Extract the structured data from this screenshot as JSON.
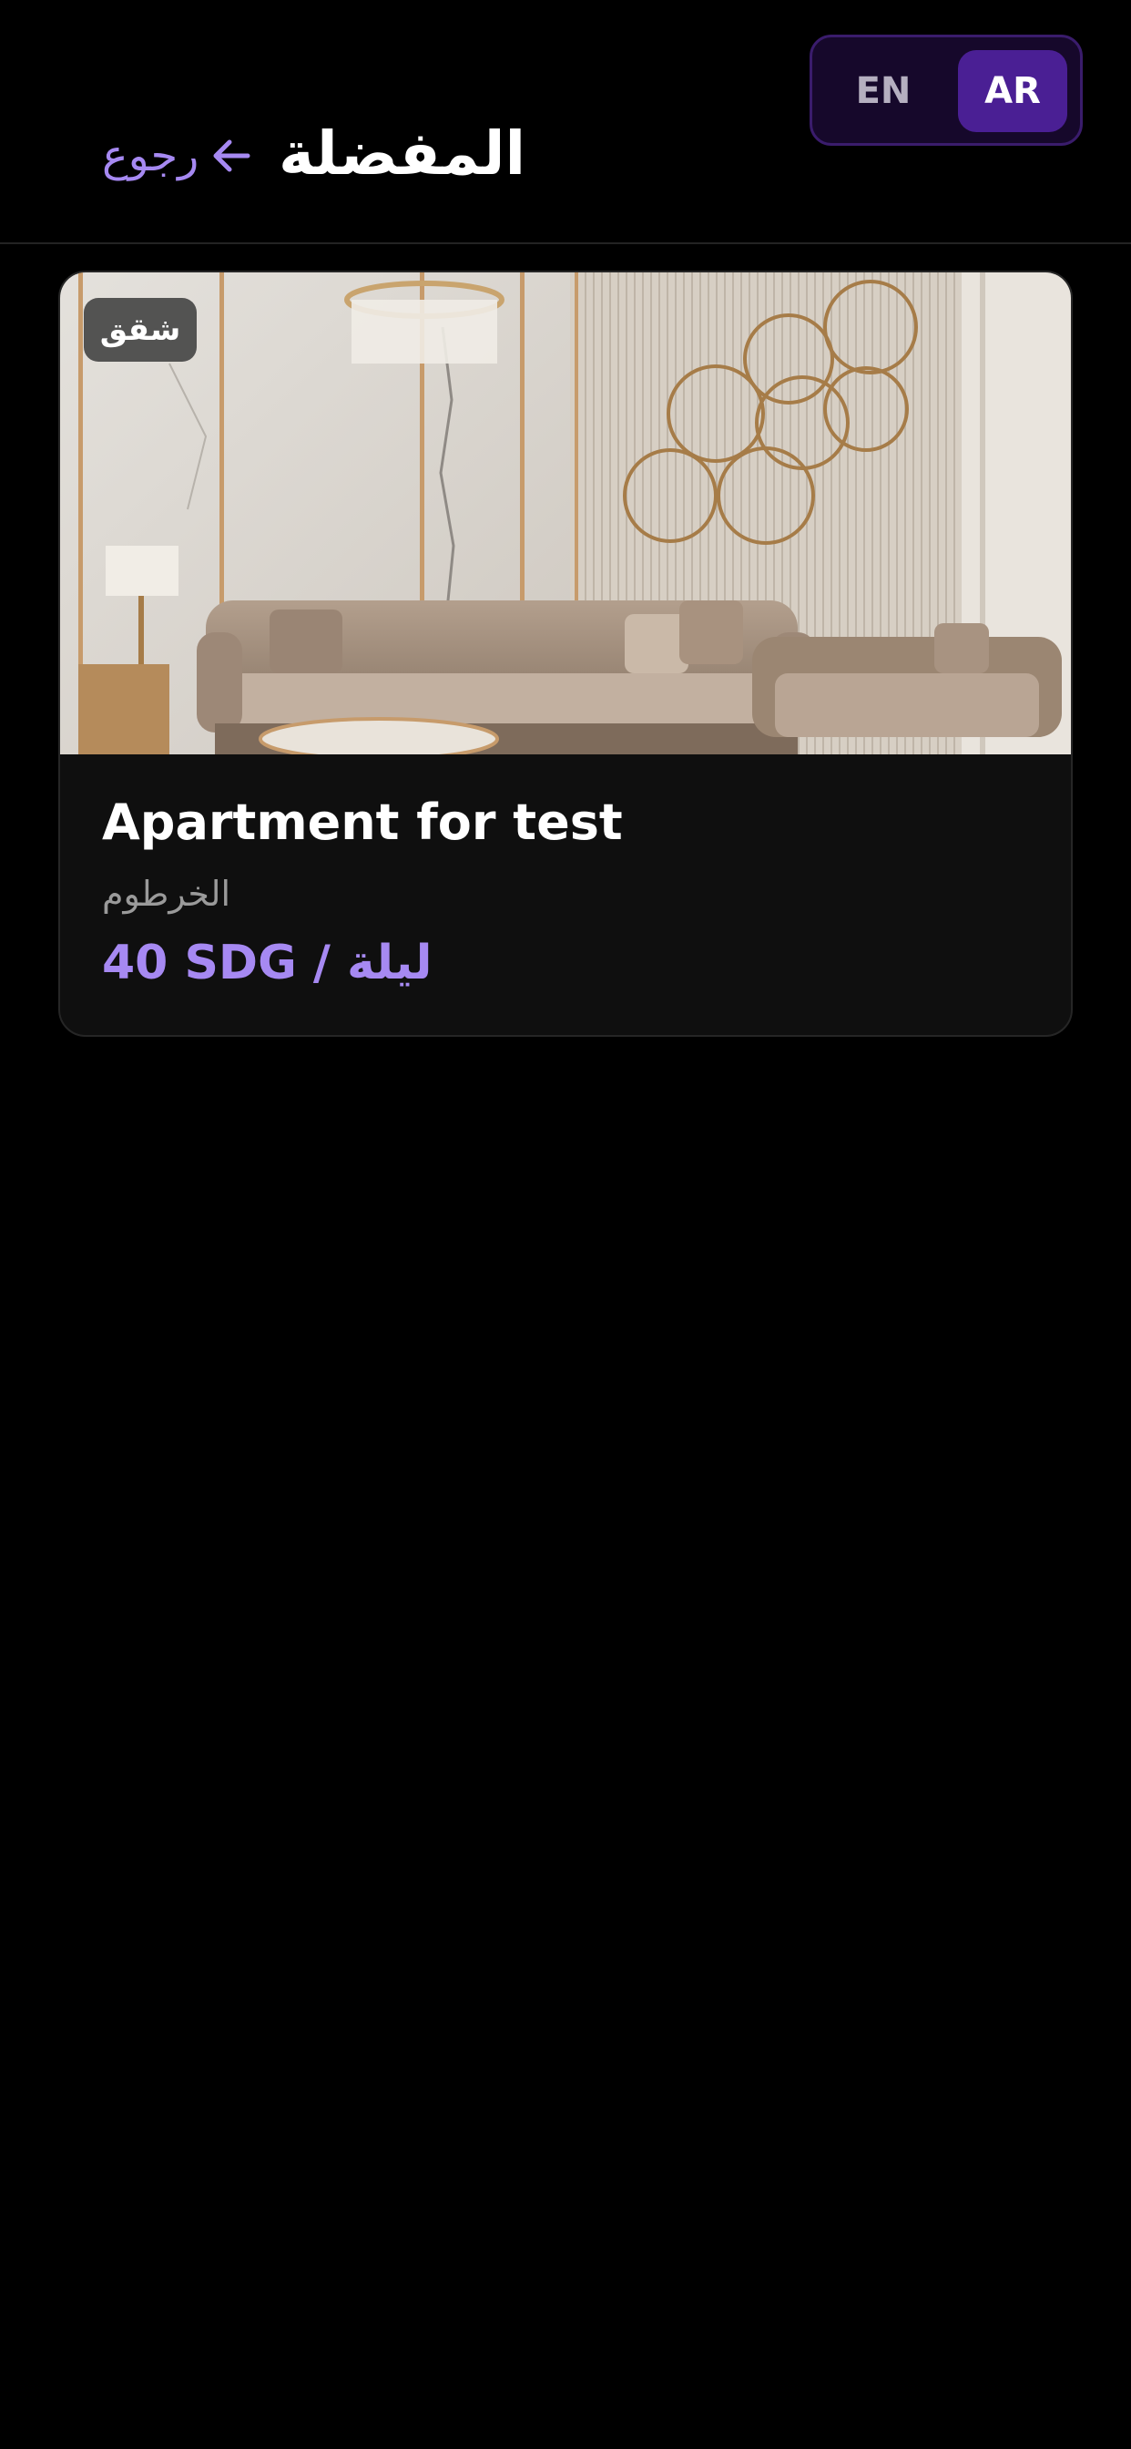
{
  "language_toggle": {
    "en_label": "EN",
    "ar_label": "AR",
    "selected": "AR"
  },
  "header": {
    "title": "المفضلة",
    "back_label": "رجوع"
  },
  "colors": {
    "accent": "#a689f2",
    "toggle_active": "#4a1f94",
    "background": "#000000"
  },
  "favorites": [
    {
      "badge": "شقق",
      "title": "Apartment for test",
      "location": "الخرطوم",
      "price": "40 SDG / ليلة",
      "image": "living-room-photo"
    }
  ]
}
